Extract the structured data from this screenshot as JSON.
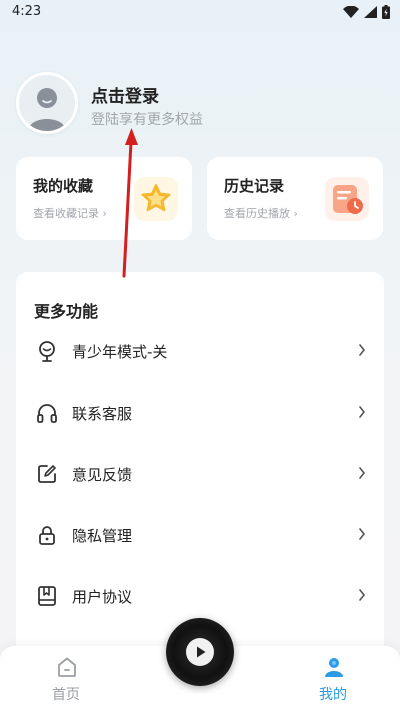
{
  "status_bar": {
    "time": "4:23",
    "icons": [
      "wifi-icon",
      "signal-icon",
      "battery-icon"
    ]
  },
  "profile": {
    "title": "点击登录",
    "subtitle": "登陆享有更多权益",
    "avatar_icon": "default-avatar-icon"
  },
  "quick_cards": {
    "favorites": {
      "title": "我的收藏",
      "subtitle": "查看收藏记录 ›",
      "icon": "star-icon",
      "accent": "#f6b82c"
    },
    "history": {
      "title": "历史记录",
      "subtitle": "查看历史播放 ›",
      "icon": "history-clock-icon",
      "accent": "#f58c68"
    }
  },
  "more_features": {
    "title": "更多功能",
    "items": [
      {
        "label": "青少年模式-关",
        "icon": "teen-mode-icon"
      },
      {
        "label": "联系客服",
        "icon": "headphones-icon"
      },
      {
        "label": "意见反馈",
        "icon": "edit-feedback-icon"
      },
      {
        "label": "隐私管理",
        "icon": "lock-icon"
      },
      {
        "label": "用户协议",
        "icon": "agreement-book-icon"
      }
    ]
  },
  "bottom_nav": {
    "items": [
      {
        "label": "首页",
        "icon": "home-icon",
        "active": false
      },
      {
        "label": "我的",
        "icon": "user-icon",
        "active": true
      }
    ],
    "active_color": "#2b9be6",
    "inactive_color": "#9a9ea4"
  },
  "player": {
    "icon": "play-icon"
  },
  "annotation": {
    "type": "arrow",
    "color": "#d21f1f"
  }
}
